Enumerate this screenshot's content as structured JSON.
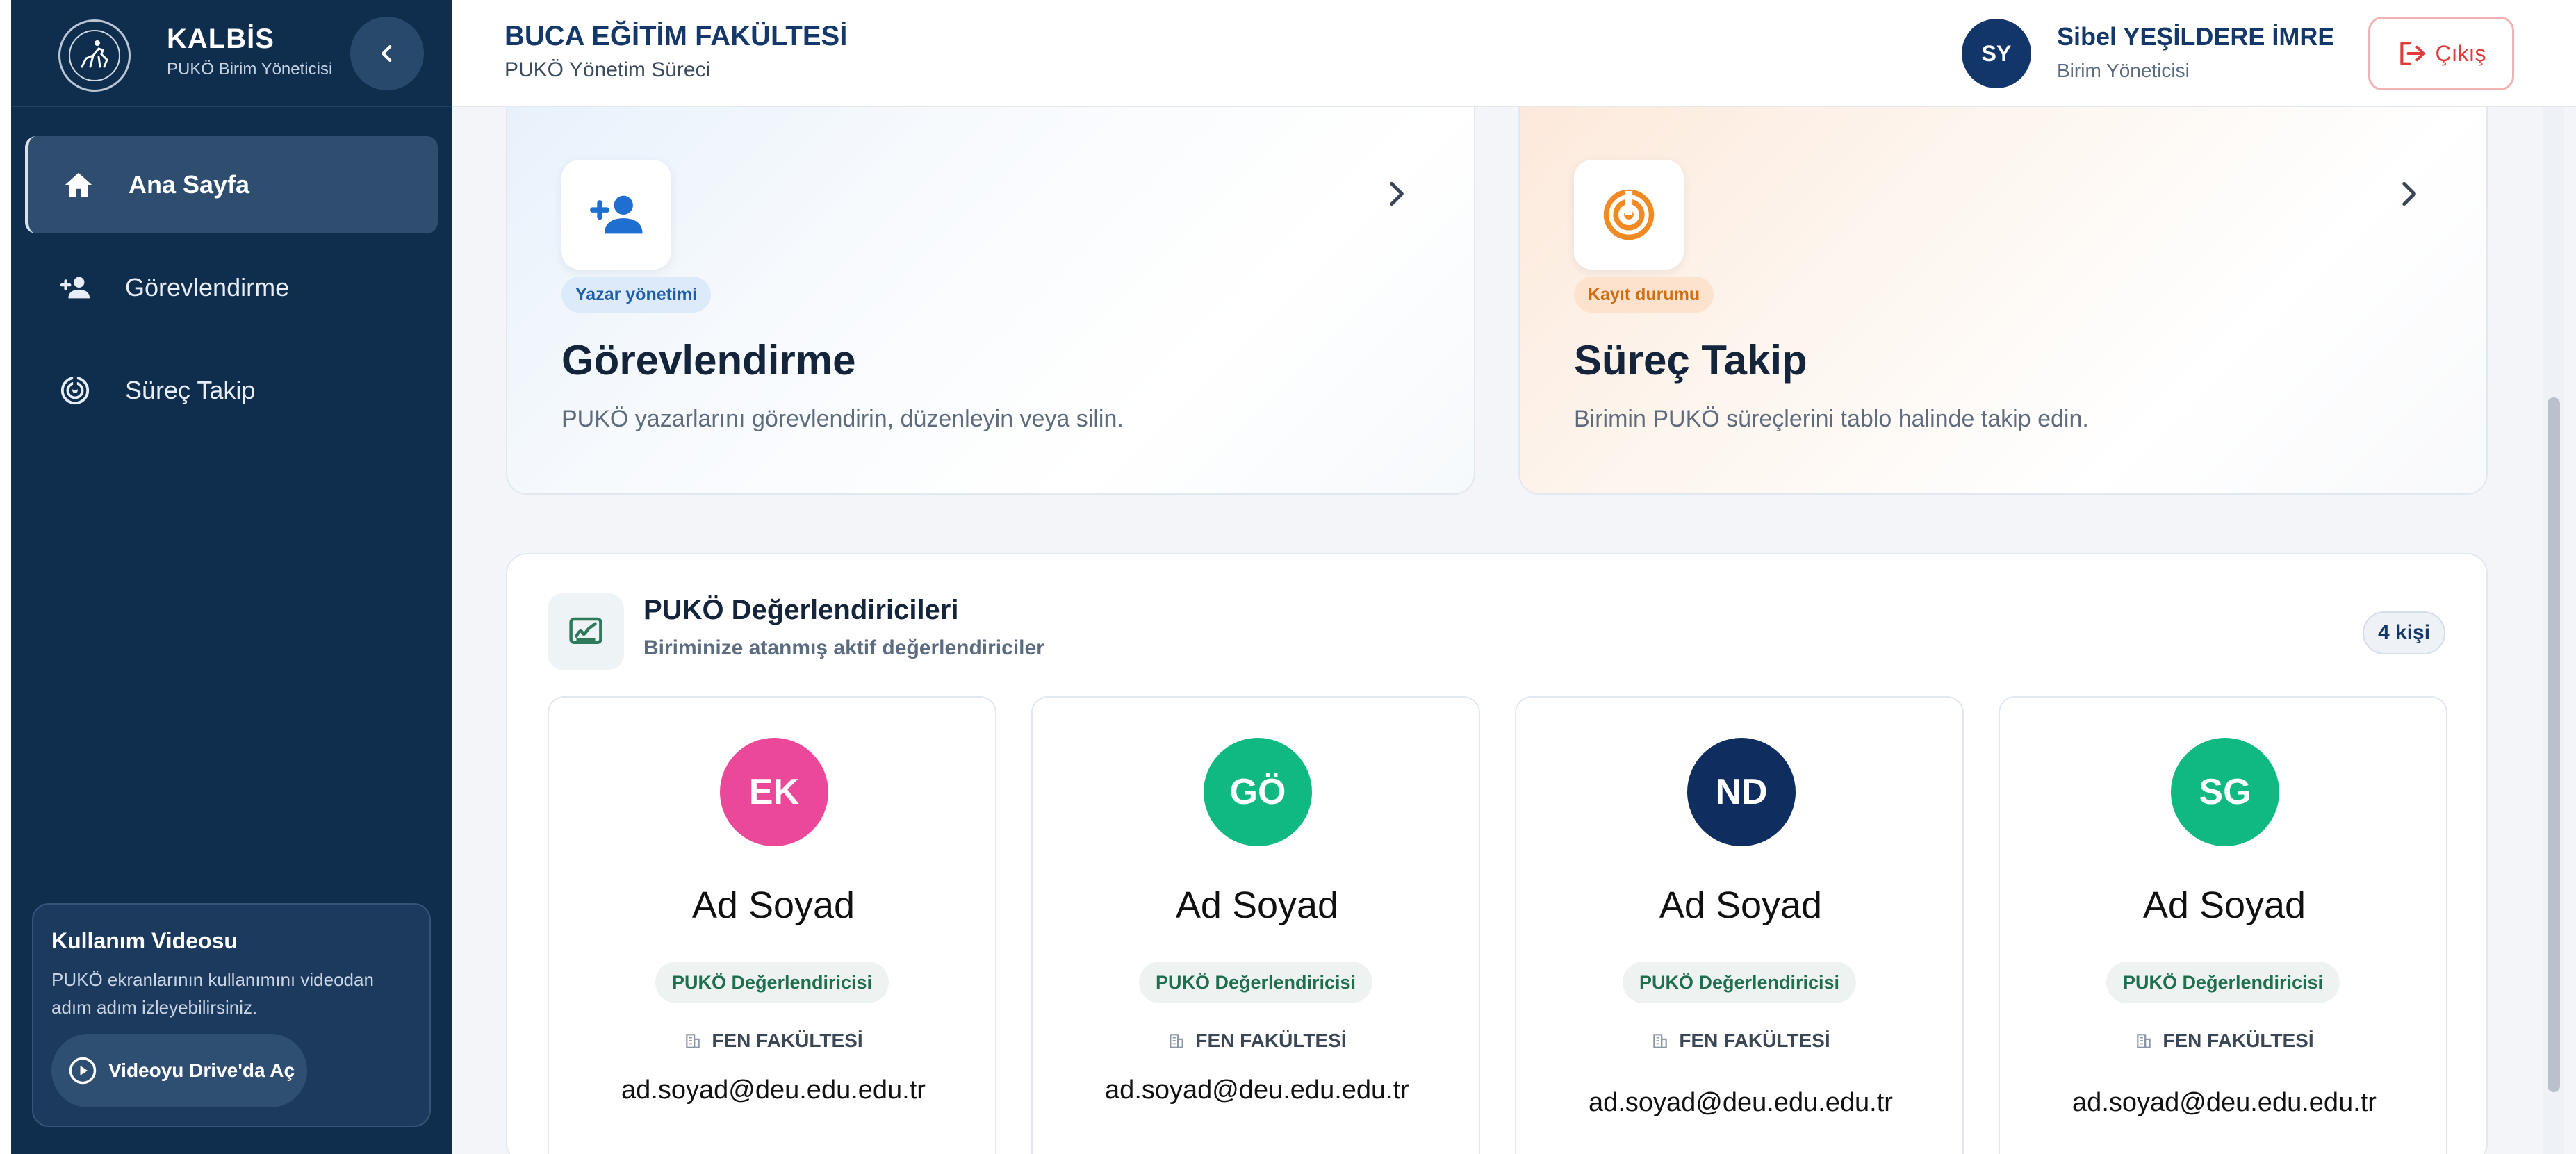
{
  "sidebar": {
    "brand_title": "KALBİS",
    "brand_subtitle": "PUKÖ Birim Yöneticisi",
    "logo_icon": "university-seal-horse-rider",
    "collapse_icon": "chevron-left-icon",
    "items": [
      {
        "label": "Ana Sayfa",
        "icon": "home-icon",
        "active": true
      },
      {
        "label": "Görevlendirme",
        "icon": "person-add-icon",
        "active": false
      },
      {
        "label": "Süreç Takip",
        "icon": "radar-icon",
        "active": false
      }
    ],
    "video": {
      "title": "Kullanım Videosu",
      "description": "PUKÖ ekranlarının kullanımını videodan adım adım izleyebilirsiniz.",
      "button_label": "Videoyu Drive'da Aç",
      "button_icon": "play-circle-icon"
    }
  },
  "header": {
    "title": "BUCA EĞİTİM FAKÜLTESİ",
    "subtitle": "PUKÖ Yönetim Süreci",
    "user_initials": "SY",
    "user_name": "Sibel YEŞİLDERE İMRE",
    "user_role": "Birim Yöneticisi",
    "logout_label": "Çıkış",
    "logout_icon": "logout-icon"
  },
  "cards": [
    {
      "badge": "Yazar yönetimi",
      "title": "Görevlendirme",
      "description": "PUKÖ yazarlarını görevlendirin, düzenleyin veya silin.",
      "icon": "person-add-icon",
      "accent": "#1f6fd1"
    },
    {
      "badge": "Kayıt durumu",
      "title": "Süreç Takip",
      "description": "Birimin PUKÖ süreçlerini tablo halinde takip edin.",
      "icon": "radar-icon",
      "accent": "#f08a24"
    }
  ],
  "evaluators": {
    "title": "PUKÖ Değerlendiricileri",
    "subtitle": "Biriminize atanmış aktif değerlendiriciler",
    "count_label": "4 kişi",
    "icon": "signature-icon",
    "items": [
      {
        "initials": "EK",
        "color": "#ec4899",
        "name": "Ad Soyad",
        "role": "PUKÖ Değerlendiricisi",
        "unit": "FEN FAKÜLTESİ",
        "email": "ad.soyad@deu.edu.edu.tr"
      },
      {
        "initials": "GÖ",
        "color": "#10b981",
        "name": "Ad Soyad",
        "role": "PUKÖ Değerlendiricisi",
        "unit": "FEN FAKÜLTESİ",
        "email": "ad.soyad@deu.edu.edu.tr"
      },
      {
        "initials": "ND",
        "color": "#0f2d5e",
        "name": "Ad Soyad",
        "role": "PUKÖ Değerlendiricisi",
        "unit": "FEN FAKÜLTESİ",
        "email": "ad.soyad@deu.edu.edu.tr"
      },
      {
        "initials": "SG",
        "color": "#10b981",
        "name": "Ad Soyad",
        "role": "PUKÖ Değerlendiricisi",
        "unit": "FEN FAKÜLTESİ",
        "email": "ad.soyad@deu.edu.edu.tr"
      }
    ]
  }
}
